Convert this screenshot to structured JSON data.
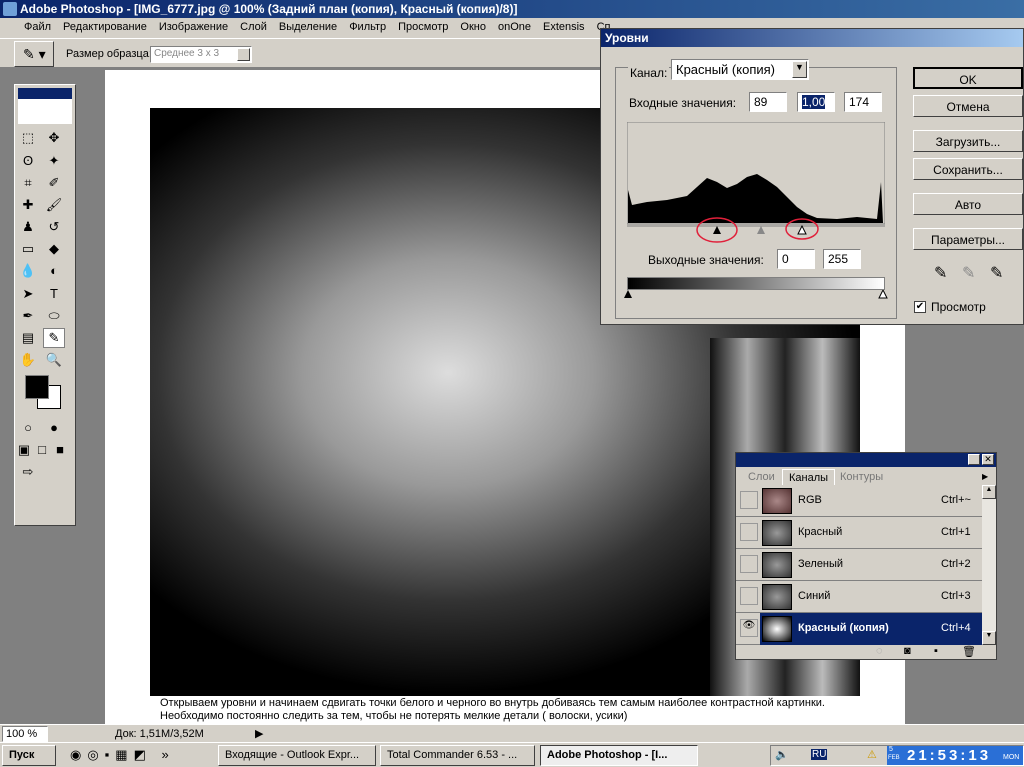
{
  "window": {
    "title": "Adobe Photoshop - [IMG_6777.jpg @ 100% (Задний план (копия), Красный (копия)/8)]"
  },
  "menu": [
    "Файл",
    "Редактирование",
    "Изображение",
    "Слой",
    "Выделение",
    "Фильтр",
    "Просмотр",
    "Окно",
    "onOne",
    "Extensis",
    "Сп"
  ],
  "options": {
    "sample_label": "Размер образца:",
    "sample_value": "Среднее 3 x 3"
  },
  "caption": "Открываем уровни и начинаем сдвигать точки белого и черного во внутрь добиваясь тем самым наиболее контрастной картинки. Необходимо постоянно следить за тем, чтобы не потерять мелкие детали ( волоски, усики)",
  "status": {
    "zoom": "100 %",
    "doc": "Док: 1,51M/3,52M"
  },
  "levels": {
    "title": "Уровни",
    "channel_label": "Канал:",
    "channel_value": "Красный (копия)",
    "input_label": "Входные значения:",
    "input_black": "89",
    "input_gamma": "1,00",
    "input_white": "174",
    "output_label": "Выходные значения:",
    "output_black": "0",
    "output_white": "255",
    "buttons": {
      "ok": "OK",
      "cancel": "Отмена",
      "load": "Загрузить...",
      "save": "Сохранить...",
      "auto": "Авто",
      "options": "Параметры..."
    },
    "preview_label": "Просмотр",
    "preview_checked": true
  },
  "channels": {
    "tabs": [
      "Слои",
      "Каналы",
      "Контуры"
    ],
    "active_tab": "Каналы",
    "rows": [
      {
        "name": "RGB",
        "shortcut": "Ctrl+~"
      },
      {
        "name": "Красный",
        "shortcut": "Ctrl+1"
      },
      {
        "name": "Зеленый",
        "shortcut": "Ctrl+2"
      },
      {
        "name": "Синий",
        "shortcut": "Ctrl+3"
      },
      {
        "name": "Красный (копия)",
        "shortcut": "Ctrl+4",
        "selected": true,
        "visible": true
      }
    ]
  },
  "taskbar": {
    "start": "Пуск",
    "tasks": [
      "Входящие - Outlook Expr...",
      "Total Commander 6.53 - ...",
      "Adobe Photoshop - [I..."
    ],
    "lang": "RU",
    "clock": "21:53:13",
    "date_day": "5",
    "date_month": "FEB",
    "weekday": "MON"
  },
  "colors": {
    "titlebar": "#0a246a",
    "face": "#d4d0c8",
    "selection": "#0a246a",
    "annotation_circle": "#e0203a"
  }
}
